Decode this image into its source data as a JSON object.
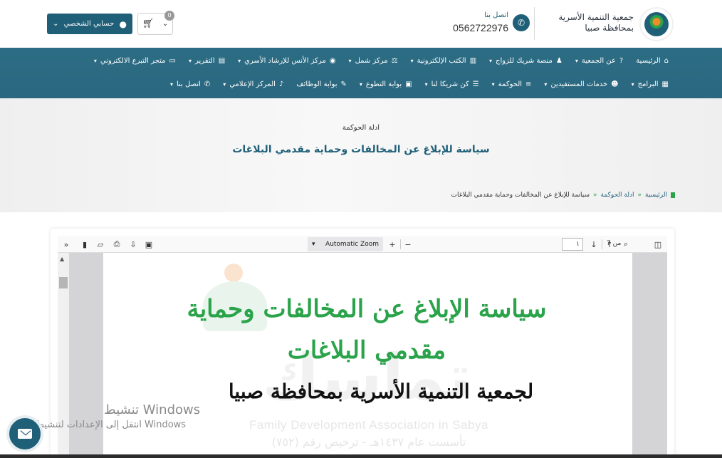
{
  "header": {
    "org_name_line1": "جمعية التنمية الأسرية",
    "org_name_line2": "بمحافظة صبيا",
    "contact_label": "اتصل بنا",
    "contact_phone": "0562722976",
    "account_label": "حسابي الشخصي",
    "cart_count": "0"
  },
  "nav": {
    "row1": [
      {
        "label": "الرئيسية",
        "icon": "home-icon",
        "glyph": "⌂",
        "chevron": false
      },
      {
        "label": "عن الجمعية",
        "icon": "question-icon",
        "glyph": "?",
        "chevron": true
      },
      {
        "label": "منصة شريك للزواج",
        "icon": "person-icon",
        "glyph": "♟",
        "chevron": true
      },
      {
        "label": "الكتب الإلكترونية",
        "icon": "book-icon",
        "glyph": "▥",
        "chevron": true
      },
      {
        "label": "مركز شمل",
        "icon": "scale-icon",
        "glyph": "⚖",
        "chevron": true
      },
      {
        "label": "مركز الأنس للإرشاد الأسري",
        "icon": "eye-icon",
        "glyph": "◉",
        "chevron": true
      },
      {
        "label": "التقرير",
        "icon": "report-icon",
        "glyph": "▤",
        "chevron": true
      },
      {
        "label": "متجر التبرع الالكتروني",
        "icon": "card-icon",
        "glyph": "▭",
        "chevron": true
      }
    ],
    "row2": [
      {
        "label": "البرامج",
        "icon": "calendar-icon",
        "glyph": "▦",
        "chevron": true
      },
      {
        "label": "خدمات المستفيدين",
        "icon": "users-icon",
        "glyph": "☻",
        "chevron": true
      },
      {
        "label": "الحوكمة",
        "icon": "list-icon",
        "glyph": "≡",
        "chevron": true
      },
      {
        "label": "كن شريكا لنا",
        "icon": "server-icon",
        "glyph": "☰",
        "chevron": true
      },
      {
        "label": "بوابة التطوع",
        "icon": "gift-icon",
        "glyph": "▣",
        "chevron": true
      },
      {
        "label": "بوابة الوظائف",
        "icon": "edit-icon",
        "glyph": "✎",
        "chevron": false
      },
      {
        "label": "المركز الإعلامي",
        "icon": "mic-icon",
        "glyph": "♪",
        "chevron": true
      },
      {
        "label": "اتصل بنا",
        "icon": "phone-icon",
        "glyph": "✆",
        "chevron": true
      }
    ]
  },
  "hero": {
    "subtitle": "ادلة الحوكمة",
    "title": "سياسة للإبلاغ عن المخالفات وحماية مقدمي البلاغات"
  },
  "breadcrumb": {
    "home": "الرئيسية",
    "section": "ادلة الحوكمة",
    "current": "سياسة للإبلاغ عن المخالفات وحماية مقدمي البلاغات",
    "separator": "»"
  },
  "pdf_viewer": {
    "page_number": "١",
    "page_total": "من 7",
    "zoom_label": "Automatic Zoom",
    "document": {
      "title": "سياسة الإبلاغ عن المخالفات وحماية مقدمي البلاغات",
      "subtitle": "لجمعية التنمية الأسرية بمحافظة صبيا",
      "watermark_big": "تماسك",
      "watermark_english": "Family Development Association in Sabya",
      "watermark_license": "تأسست عام ١٤٣٧هـ - ترخيص رقم (٧٥٢)"
    }
  },
  "windows_activation": {
    "title": "تنشيط Windows",
    "subtitle": "انتقل إلى الإعدادات لتنشيط Windows"
  },
  "colors": {
    "primary": "#1f5f78",
    "nav_bg": "#2d6d84",
    "accent_green": "#2aa34a"
  }
}
